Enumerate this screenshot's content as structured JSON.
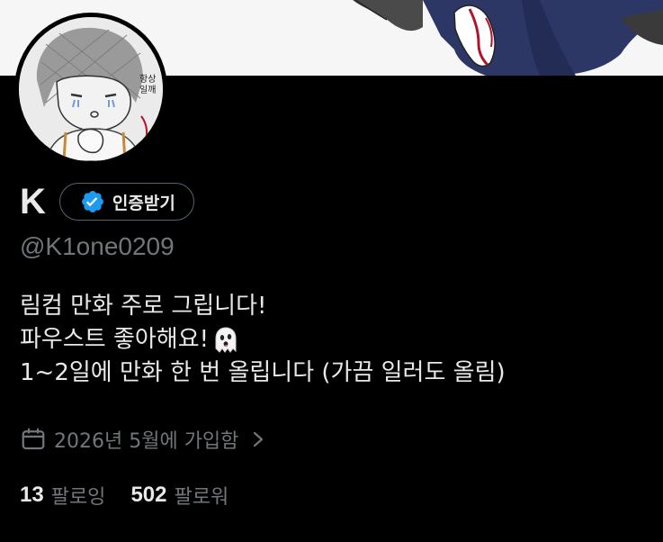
{
  "profile": {
    "display_name": "K",
    "verify_button_label": "인증받기",
    "handle": "@K1one0209",
    "bio_lines": [
      "림컴 만화 주로 그립니다!",
      "파우스트 좋아해요!",
      "1~2일에 만화 한 번 올립니다 (가끔 일러도 올림)"
    ],
    "bio_emoji": "ghost-emoji",
    "joined_text": "2026년 5월에 가입함",
    "following_count": "13",
    "following_label": "팔로잉",
    "followers_count": "502",
    "followers_label": "팔로워",
    "avatar_text": "항상 일깨"
  },
  "icons": {
    "verified_badge": "verified-badge-icon",
    "calendar": "calendar-icon",
    "chevron": "chevron-right-icon"
  },
  "colors": {
    "background": "#000000",
    "primary_text": "#e7e9ea",
    "secondary_text": "#71767b",
    "verified_blue": "#1d9bf0",
    "button_border": "#536471"
  }
}
